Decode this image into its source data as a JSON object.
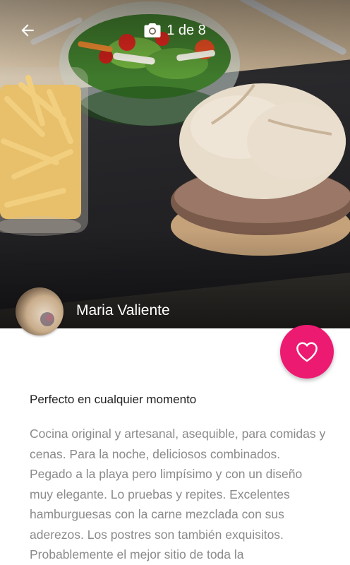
{
  "header": {
    "back_icon": "arrow-left-icon",
    "camera_icon": "camera-icon",
    "photo_counter": "1 de 8"
  },
  "owner": {
    "name": "Maria Valiente"
  },
  "favorite": {
    "icon": "heart-icon",
    "color": "#ed1a71"
  },
  "review": {
    "title": "Perfecto en cualquier momento",
    "body": "Cocina original y artesanal, asequible, para comidas y cenas. Para la noche, deliciosos combinados. Pegado a la playa pero limpísimo y con un diseño muy elegante. Lo pruebas y repites. Excelentes hamburguesas con la carne mezclada con sus aderezos. Los postres son también exquisitos. Probablemente el mejor sitio de toda la"
  }
}
